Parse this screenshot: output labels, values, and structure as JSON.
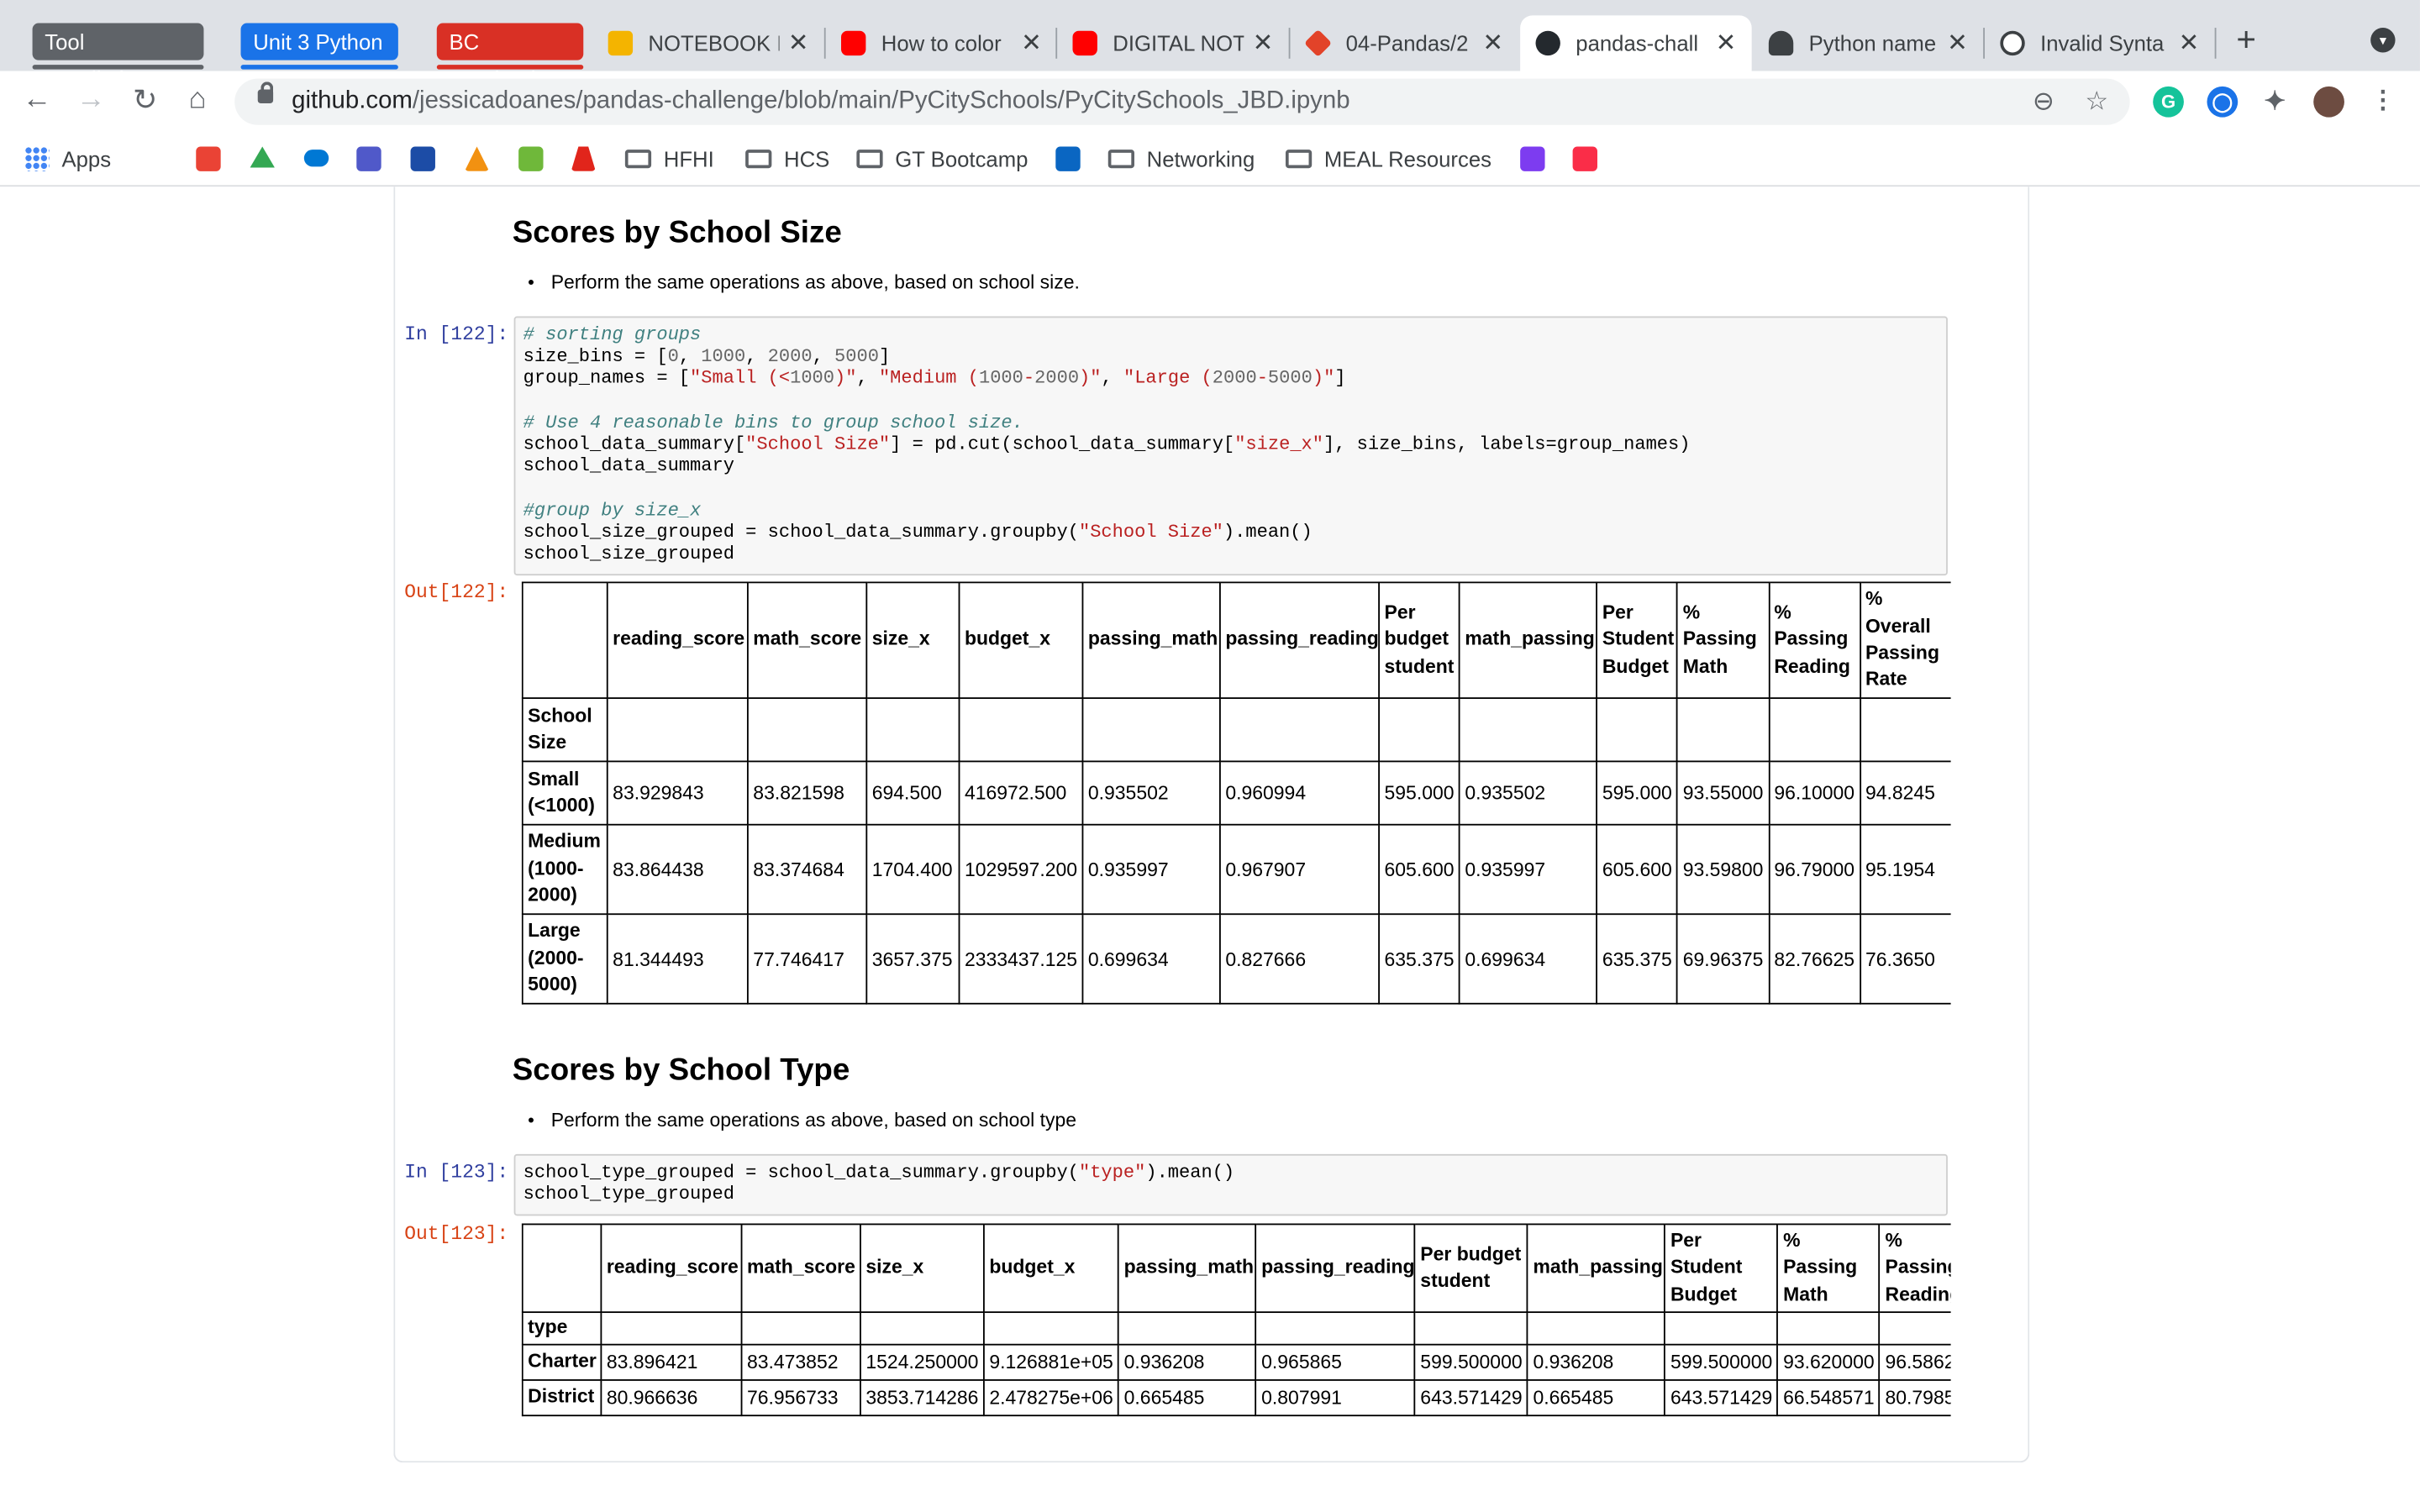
{
  "tab_groups": [
    "Tool Installation",
    "Unit 3 Python",
    "BC Notebook"
  ],
  "tabs": [
    {
      "title": "NOTEBOOK I",
      "icon": "notebook-icon",
      "color": "#f4b400"
    },
    {
      "title": "How to color",
      "icon": "youtube-icon",
      "color": "#ff0000"
    },
    {
      "title": "DIGITAL NOT",
      "icon": "youtube-icon",
      "color": "#ff0000"
    },
    {
      "title": "04-Pandas/2",
      "icon": "gitlab-icon",
      "color": "#e24329"
    },
    {
      "title": "pandas-chall",
      "icon": "github-icon",
      "color": "#24292e"
    },
    {
      "title": "Python name",
      "icon": "python-icon",
      "color": "#3c4043"
    },
    {
      "title": "Invalid Synta",
      "icon": "web-icon",
      "color": "#3c4043"
    }
  ],
  "address": {
    "host": "github.com",
    "path": "/jessicadoanes/pandas-challenge/blob/main/PyCitySchools/PyCitySchools_JBD.ipynb"
  },
  "bookmarks": [
    "Apps",
    "HFHI",
    "HCS",
    "GT Bootcamp",
    "Networking",
    "MEAL Resources"
  ],
  "notebook": {
    "size_section": {
      "heading": "Scores by School Size",
      "bullet": "Perform the same operations as above, based on school size.",
      "in_prompt": "In [122]:",
      "out_prompt": "Out[122]:",
      "code": [
        {
          "t": "# sorting groups",
          "c": "cm"
        },
        {
          "t": "size_bins = [0, 1000, 2000, 5000]",
          "c": ""
        },
        {
          "t": "group_names = [\"Small (<1000)\", \"Medium (1000-2000)\", \"Large (2000-5000)\"]",
          "c": ""
        },
        {
          "t": "",
          "c": ""
        },
        {
          "t": "# Use 4 reasonable bins to group school size.",
          "c": "cm"
        },
        {
          "t": "school_data_summary[\"School Size\"] = pd.cut(school_data_summary[\"size_x\"], size_bins, labels=group_names)",
          "c": ""
        },
        {
          "t": "school_data_summary",
          "c": ""
        },
        {
          "t": "",
          "c": ""
        },
        {
          "t": "#group by size_x",
          "c": "cm"
        },
        {
          "t": "school_size_grouped = school_data_summary.groupby(\"School Size\").mean()",
          "c": ""
        },
        {
          "t": "school_size_grouped",
          "c": ""
        }
      ],
      "table": {
        "columns": [
          "reading_score",
          "math_score",
          "size_x",
          "budget_x",
          "passing_math",
          "passing_reading",
          "Per budget student",
          "math_passing",
          "Per Student Budget",
          "% Passing Math",
          "% Passing Reading",
          "% Overall Passing Rate"
        ],
        "index_name": "School Size",
        "rows": [
          {
            "label": "Small (<1000)",
            "values": [
              "83.929843",
              "83.821598",
              "694.500",
              "416972.500",
              "0.935502",
              "0.960994",
              "595.000",
              "0.935502",
              "595.000",
              "93.55000",
              "96.10000",
              "94.8245"
            ]
          },
          {
            "label": "Medium (1000-2000)",
            "values": [
              "83.864438",
              "83.374684",
              "1704.400",
              "1029597.200",
              "0.935997",
              "0.967907",
              "605.600",
              "0.935997",
              "605.600",
              "93.59800",
              "96.79000",
              "95.1954"
            ]
          },
          {
            "label": "Large (2000-5000)",
            "values": [
              "81.344493",
              "77.746417",
              "3657.375",
              "2333437.125",
              "0.699634",
              "0.827666",
              "635.375",
              "0.699634",
              "635.375",
              "69.96375",
              "82.76625",
              "76.3650"
            ]
          }
        ]
      }
    },
    "type_section": {
      "heading": "Scores by School Type",
      "bullet": "Perform the same operations as above, based on school type",
      "in_prompt": "In [123]:",
      "out_prompt": "Out[123]:",
      "code": [
        {
          "t": "school_type_grouped = school_data_summary.groupby(\"type\").mean()",
          "c": ""
        },
        {
          "t": "school_type_grouped",
          "c": ""
        }
      ],
      "table": {
        "columns": [
          "reading_score",
          "math_score",
          "size_x",
          "budget_x",
          "passing_math",
          "passing_reading",
          "Per budget student",
          "math_passing",
          "Per Student Budget",
          "% Passing Math",
          "% Passing Reading"
        ],
        "index_name": "type",
        "rows": [
          {
            "label": "Charter",
            "values": [
              "83.896421",
              "83.473852",
              "1524.250000",
              "9.126881e+05",
              "0.936208",
              "0.965865",
              "599.500000",
              "0.936208",
              "599.500000",
              "93.620000",
              "96.586200"
            ]
          },
          {
            "label": "District",
            "values": [
              "80.966636",
              "76.956733",
              "3853.714286",
              "2.478275e+06",
              "0.665485",
              "0.807991",
              "643.571429",
              "0.665485",
              "643.571429",
              "66.548571",
              "80.798500"
            ]
          }
        ]
      }
    }
  }
}
